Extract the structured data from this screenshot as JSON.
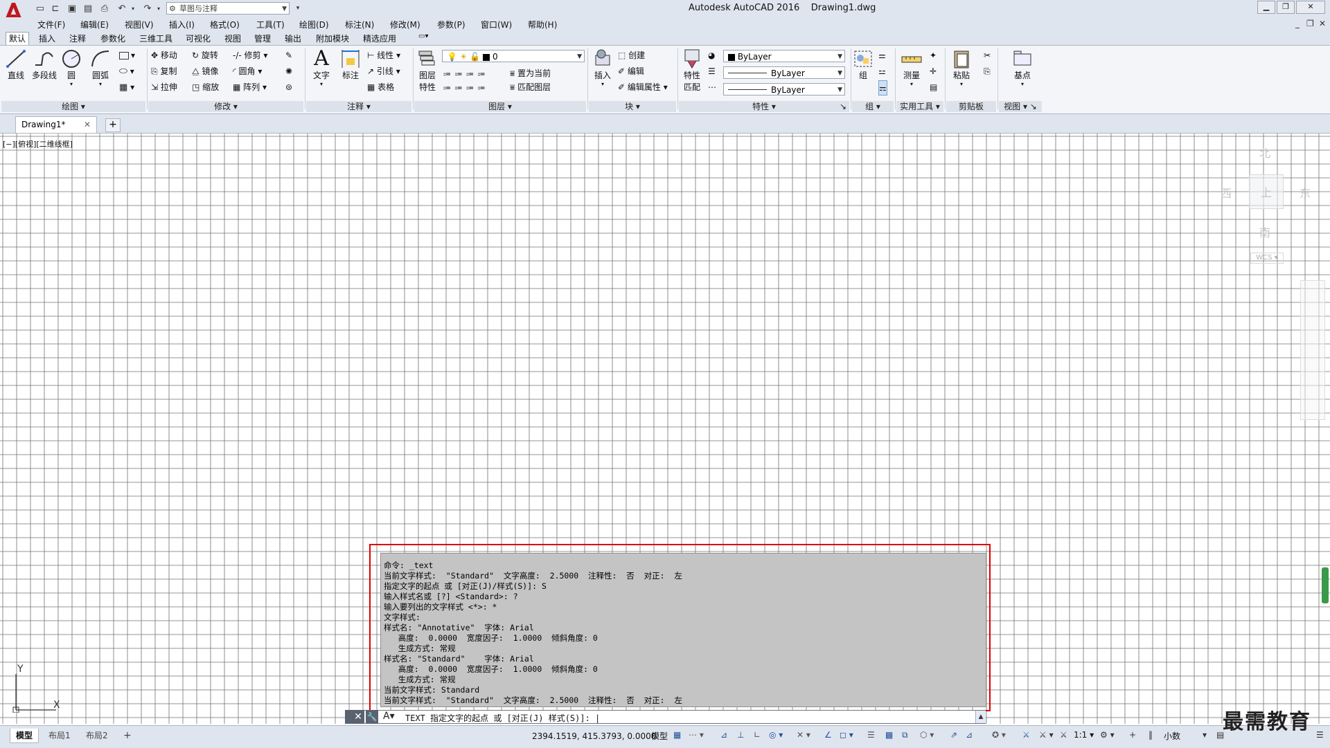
{
  "app": {
    "title": "Autodesk AutoCAD 2016    Drawing1.dwg",
    "workspace": "草图与注释"
  },
  "menu": [
    "文件(F)",
    "编辑(E)",
    "视图(V)",
    "插入(I)",
    "格式(O)",
    "工具(T)",
    "绘图(D)",
    "标注(N)",
    "修改(M)",
    "参数(P)",
    "窗口(W)",
    "帮助(H)"
  ],
  "ribbon_tabs": [
    "默认",
    "插入",
    "注释",
    "参数化",
    "三维工具",
    "可视化",
    "视图",
    "管理",
    "输出",
    "附加模块",
    "精选应用"
  ],
  "ribbon": {
    "draw": {
      "title": "绘图",
      "line": "直线",
      "polyline": "多段线",
      "circle": "圆",
      "arc": "圆弧"
    },
    "modify": {
      "title": "修改",
      "move": "移动",
      "rotate": "旋转",
      "trim": "修剪",
      "copy": "复制",
      "mirror": "镜像",
      "fillet": "圆角",
      "stretch": "拉伸",
      "scale": "缩放",
      "array": "阵列"
    },
    "annotation": {
      "title": "注释",
      "text": "文字",
      "dimension": "标注",
      "linear": "线性",
      "leader": "引线",
      "table": "表格"
    },
    "layers": {
      "title": "图层",
      "layer_props": "图层\n特性",
      "layer_props_1": "图层",
      "layer_props_2": "特性",
      "layer_value": "0",
      "set_current": "置为当前",
      "match_layer": "匹配图层"
    },
    "block": {
      "title": "块",
      "insert": "插入",
      "create": "创建",
      "edit": "编辑",
      "edit_attr": "编辑属性"
    },
    "properties": {
      "title": "特性",
      "match_1": "特性",
      "match_2": "匹配",
      "color": "ByLayer",
      "linetype": "ByLayer",
      "lineweight": "ByLayer"
    },
    "groups": {
      "title": "组",
      "group": "组"
    },
    "utilities": {
      "title": "实用工具",
      "measure": "测量"
    },
    "clipboard": {
      "title": "剪贴板",
      "paste": "粘贴"
    },
    "view": {
      "title": "视图",
      "base": "基点"
    }
  },
  "doc_tab": {
    "name": "Drawing1*"
  },
  "viewport_label": "[−][俯视][二维线框]",
  "viewcube": {
    "north": "北",
    "south": "南",
    "east": "东",
    "west": "西",
    "top": "上",
    "wcs": "WCS"
  },
  "command_history": [
    "命令: _text",
    "当前文字样式:  \"Standard\"  文字高度:  2.5000  注释性:  否  对正:  左",
    "指定文字的起点 或 [对正(J)/样式(S)]: S",
    "输入样式名或 [?] <Standard>: ?",
    "输入要列出的文字样式 <*>: *",
    "文字样式:",
    "样式名: \"Annotative\"  字体: Arial",
    "   高度:  0.0000  宽度因子:  1.0000  倾斜角度: 0",
    "   生成方式: 常规",
    "样式名: \"Standard\"    字体: Arial",
    "   高度:  0.0000  宽度因子:  1.0000  倾斜角度: 0",
    "   生成方式: 常规",
    "当前文字样式: Standard",
    "当前文字样式:  \"Standard\"  文字高度:  2.5000  注释性:  否  对正:  左"
  ],
  "command_prompt": "TEXT 指定文字的起点 或 [对正(J) 样式(S)]: |",
  "layout_tabs": [
    "模型",
    "布局1",
    "布局2"
  ],
  "status": {
    "coords": "2394.1519, 415.3793, 0.0000",
    "model": "模型",
    "scale": "1:1",
    "units": "小数"
  },
  "watermark": "最需教育",
  "ucs": {
    "x": "X",
    "y": "Y"
  },
  "colors": {
    "accent": "#c0171f",
    "highlight": "#e00000",
    "grid": "#707070"
  }
}
